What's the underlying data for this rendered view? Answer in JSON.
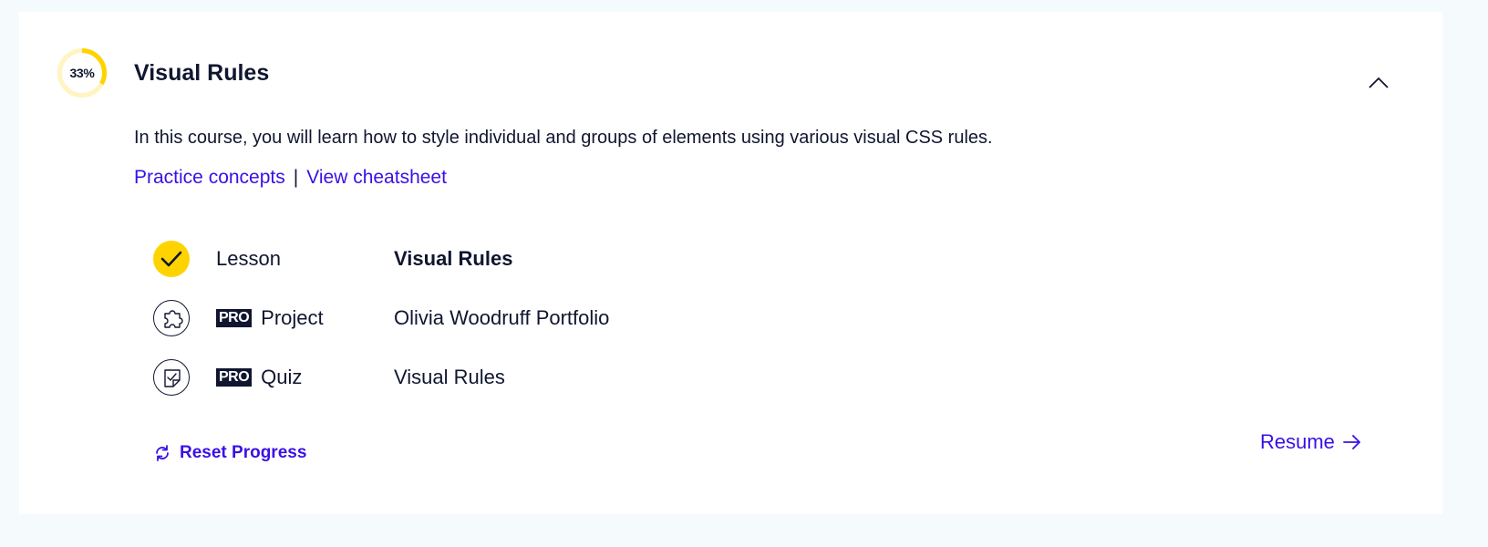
{
  "course": {
    "progress_percent": 33,
    "progress_label": "33%",
    "title": "Visual Rules",
    "description": "In this course, you will learn how to style individual and groups of elements using various visual CSS rules.",
    "collapse_icon": "chevron-up-icon"
  },
  "links": {
    "practice_label": "Practice concepts",
    "separator": "|",
    "cheatsheet_label": "View cheatsheet"
  },
  "items": [
    {
      "type": "Lesson",
      "name": "Visual Rules",
      "completed": true,
      "pro": false,
      "icon": "check-icon"
    },
    {
      "type": "Project",
      "name": "Olivia Woodruff Portfolio",
      "completed": false,
      "pro": true,
      "badge": "PRO",
      "icon": "puzzle-icon"
    },
    {
      "type": "Quiz",
      "name": "Visual Rules",
      "completed": false,
      "pro": true,
      "badge": "PRO",
      "icon": "quiz-icon"
    }
  ],
  "footer": {
    "reset_label": "Reset Progress",
    "reset_icon": "refresh-icon",
    "resume_label": "Resume",
    "resume_icon": "arrow-right-icon"
  },
  "colors": {
    "accent": "#3a10e5",
    "progress": "#ffd300",
    "progress_track": "#fff4c2",
    "text": "#10162f",
    "background": "#f5fbfd"
  }
}
